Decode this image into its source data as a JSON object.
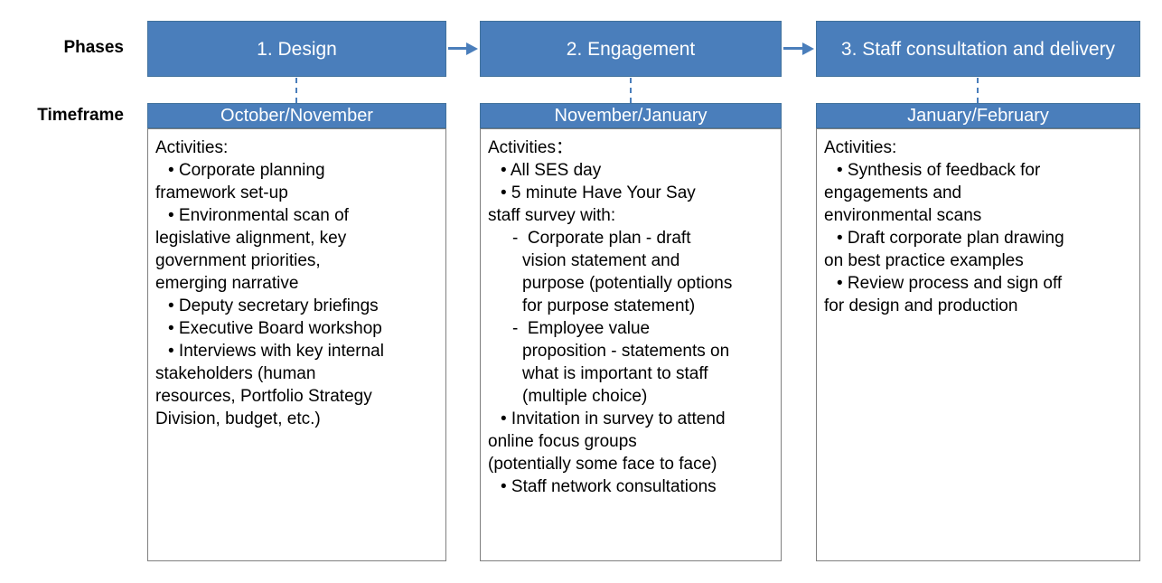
{
  "theme": {
    "accent_blue": "#4a7ebb",
    "accent_blue_border": "#41719c",
    "box_border": "#7f7f7f",
    "text_on_accent": "#ffffff",
    "body_text": "#000000",
    "background": "#ffffff"
  },
  "row_labels": {
    "phases": "Phases",
    "timeframe": "Timeframe"
  },
  "columns": [
    {
      "phase": "1. Design",
      "timeframe": "October/November",
      "activities_heading": "Activities:",
      "activities": [
        {
          "style": "bullet",
          "text": "• Corporate planning"
        },
        {
          "style": "cont",
          "text": "framework set-up"
        },
        {
          "style": "bullet",
          "text": "• Environmental scan of"
        },
        {
          "style": "cont",
          "text": "legislative alignment, key"
        },
        {
          "style": "cont",
          "text": "government priorities,"
        },
        {
          "style": "cont",
          "text": "emerging narrative"
        },
        {
          "style": "bullet",
          "text": "• Deputy secretary briefings"
        },
        {
          "style": "bullet",
          "text": "• Executive Board workshop"
        },
        {
          "style": "bullet",
          "text": "• Interviews with key internal"
        },
        {
          "style": "cont",
          "text": "stakeholders (human"
        },
        {
          "style": "cont",
          "text": "resources, Portfolio Strategy"
        },
        {
          "style": "cont",
          "text": "Division, budget, etc.)"
        }
      ]
    },
    {
      "phase": "2. Engagement",
      "timeframe": "November/January",
      "activities_heading": "Activities：",
      "activities": [
        {
          "style": "bullet",
          "text": "• All SES day"
        },
        {
          "style": "bullet",
          "text": "• 5 minute Have Your Say"
        },
        {
          "style": "cont",
          "text": "staff survey with:"
        },
        {
          "style": "sub",
          "text": "-  Corporate plan - draft"
        },
        {
          "style": "sub-cont",
          "text": "vision statement and"
        },
        {
          "style": "sub-cont",
          "text": "purpose (potentially options"
        },
        {
          "style": "sub-cont",
          "text": "for purpose statement)"
        },
        {
          "style": "sub",
          "text": "-  Employee value"
        },
        {
          "style": "sub-cont",
          "text": "proposition - statements on"
        },
        {
          "style": "sub-cont",
          "text": "what is important to staff"
        },
        {
          "style": "sub-cont",
          "text": "(multiple choice)"
        },
        {
          "style": "bullet",
          "text": "• Invitation in survey to attend"
        },
        {
          "style": "cont",
          "text": "online focus groups"
        },
        {
          "style": "cont",
          "text": "(potentially some face to face)"
        },
        {
          "style": "bullet",
          "text": "• Staff network consultations"
        }
      ]
    },
    {
      "phase": "3. Staff consultation and delivery",
      "timeframe": "January/February",
      "activities_heading": "Activities:",
      "activities": [
        {
          "style": "bullet",
          "text": "• Synthesis of feedback for"
        },
        {
          "style": "cont",
          "text": "engagements and"
        },
        {
          "style": "cont",
          "text": "environmental scans"
        },
        {
          "style": "bullet",
          "text": "• Draft corporate plan drawing"
        },
        {
          "style": "cont",
          "text": "on best practice examples"
        },
        {
          "style": "bullet",
          "text": "• Review process and sign off"
        },
        {
          "style": "cont",
          "text": "for design and production"
        }
      ]
    }
  ],
  "connectors": {
    "phase_arrows": [
      {
        "from": "1. Design",
        "to": "2. Engagement"
      },
      {
        "from": "2. Engagement",
        "to": "3. Staff consultation and delivery"
      }
    ]
  }
}
